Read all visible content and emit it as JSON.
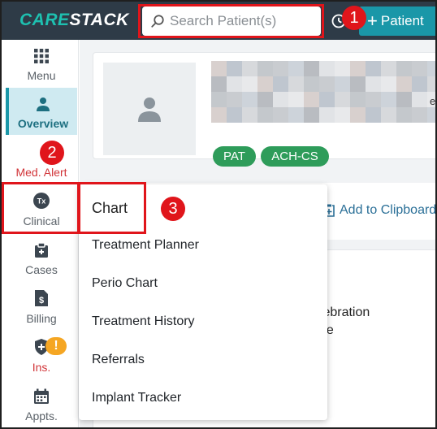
{
  "topbar": {
    "logo_care": "CARE",
    "logo_stack": "STACK",
    "search_placeholder": "Search Patient(s)",
    "new_patient_label": "Patient"
  },
  "sidebar": {
    "items": [
      {
        "label": "Menu",
        "icon": "grid-icon"
      },
      {
        "label": "Overview",
        "icon": "person-icon"
      },
      {
        "label": "Med. Alert",
        "icon": "alert-icon"
      },
      {
        "label": "Clinical",
        "icon": "tx-icon"
      },
      {
        "label": "Cases",
        "icon": "cases-icon"
      },
      {
        "label": "Billing",
        "icon": "billing-icon"
      },
      {
        "label": "Ins.",
        "icon": "insurance-icon"
      },
      {
        "label": "Appts.",
        "icon": "calendar-icon"
      }
    ],
    "ins_alert": "!"
  },
  "patient": {
    "tags": [
      "PAT",
      "ACH-CS"
    ],
    "edge_text": "e"
  },
  "clipboard": {
    "label": "Add to Clipboard"
  },
  "content": {
    "fragment1": "elebration",
    "fragment2": "rcle"
  },
  "clinical_menu": {
    "items": [
      "Chart",
      "Treatment Planner",
      "Perio Chart",
      "Treatment History",
      "Referrals",
      "Implant Tracker"
    ]
  },
  "callouts": [
    "1",
    "2",
    "3"
  ],
  "colors": {
    "topbar": "#2e3b47",
    "accent": "#1a97a8",
    "tag_green": "#2e9c5a",
    "callout_red": "#e0151b"
  }
}
